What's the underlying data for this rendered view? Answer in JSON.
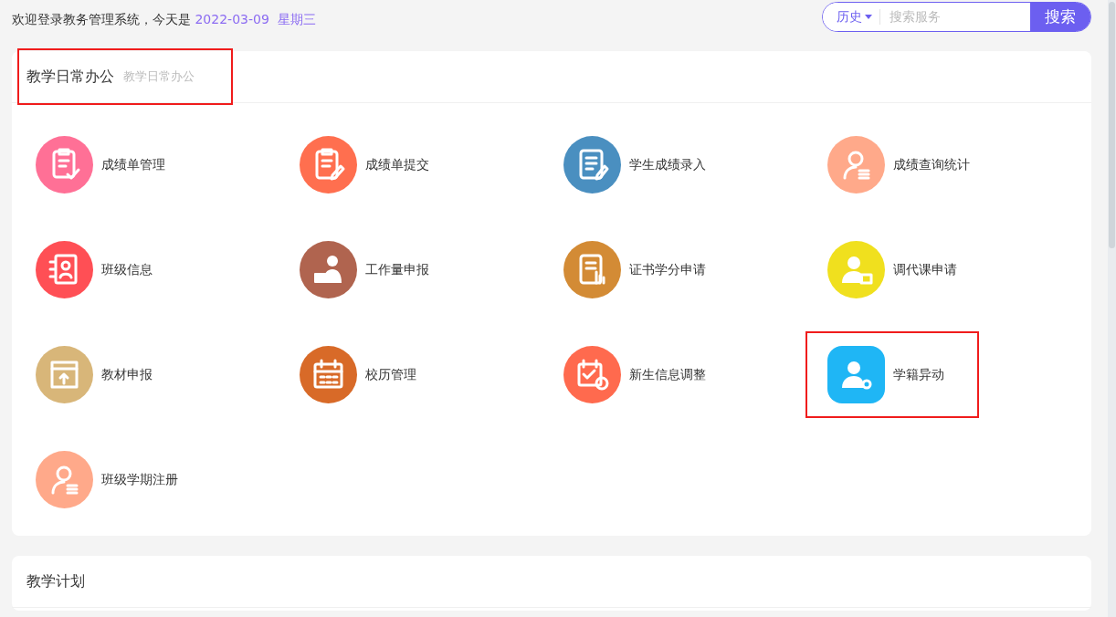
{
  "welcome": {
    "text": "欢迎登录教务管理系统，今天是",
    "date": "2022-03-09",
    "weekday": "星期三"
  },
  "search": {
    "history": "历史",
    "placeholder": "搜索服务",
    "button": "搜索"
  },
  "sections": [
    {
      "title": "教学日常办公",
      "subtitle": "教学日常办公",
      "highlighted": true,
      "items": [
        {
          "label": "成绩单管理",
          "kind": "clipboard-check",
          "color": "#ff7096",
          "highlighted": false
        },
        {
          "label": "成绩单提交",
          "kind": "clipboard-pen",
          "color": "#ff6f4f",
          "highlighted": false
        },
        {
          "label": "学生成绩录入",
          "kind": "doc-pen",
          "color": "#4a8fc0",
          "highlighted": false
        },
        {
          "label": "成绩查询统计",
          "kind": "person-list",
          "color": "#ffa98a",
          "highlighted": false
        },
        {
          "label": "班级信息",
          "kind": "contact-card",
          "color": "#ff4f55",
          "highlighted": false
        },
        {
          "label": "工作量申报",
          "kind": "person-case",
          "color": "#b0644f",
          "highlighted": false
        },
        {
          "label": "证书学分申请",
          "kind": "doc-hand",
          "color": "#d38b35",
          "highlighted": false
        },
        {
          "label": "调代课申请",
          "kind": "person-swap",
          "color": "#f0e01e",
          "highlighted": false
        },
        {
          "label": "教材申报",
          "kind": "doc-upload",
          "color": "#d8b679",
          "highlighted": false
        },
        {
          "label": "校历管理",
          "kind": "calendar",
          "color": "#d86a28",
          "highlighted": false
        },
        {
          "label": "新生信息调整",
          "kind": "calendar-check",
          "color": "#ff6a4e",
          "highlighted": false
        },
        {
          "label": "学籍异动",
          "kind": "person-gear",
          "color": "#1fb6f5",
          "highlighted": true
        },
        {
          "label": "班级学期注册",
          "kind": "person-list",
          "color": "#ffa98a",
          "highlighted": false
        }
      ]
    },
    {
      "title": "教学计划",
      "highlighted": false
    }
  ]
}
